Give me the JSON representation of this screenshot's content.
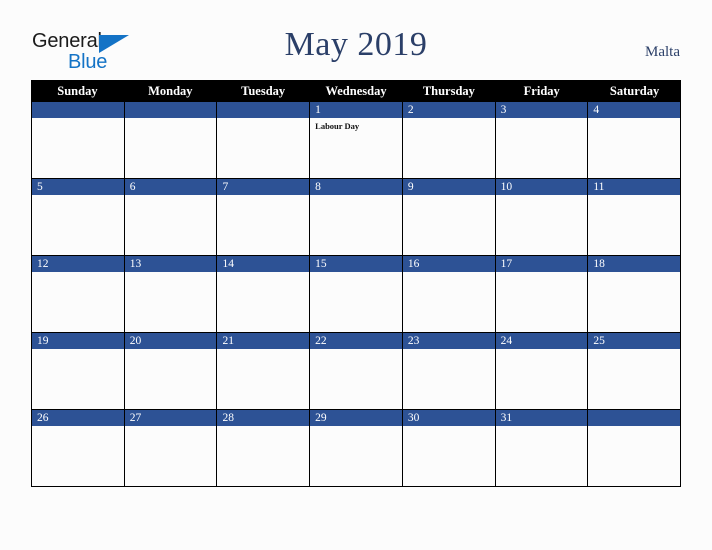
{
  "brand": {
    "logo_text_top": "General",
    "logo_text_bottom": "Blue",
    "logo_color_top": "#1b1b1b",
    "logo_color_bottom": "#1473c6",
    "triangle_color": "#1473c6"
  },
  "header": {
    "title": "May 2019",
    "country": "Malta",
    "title_color": "#2b3f68"
  },
  "theme": {
    "background": "#fcfcfc",
    "header_row_background": "#000000",
    "header_row_text": "#ffffff",
    "date_bar_background": "#2d5295",
    "date_bar_text": "#ffffff",
    "grid_line": "#000000"
  },
  "calendar": {
    "month": "May",
    "year": "2019",
    "day_headers": [
      "Sunday",
      "Monday",
      "Tuesday",
      "Wednesday",
      "Thursday",
      "Friday",
      "Saturday"
    ],
    "weeks": [
      [
        {
          "date": "",
          "event": ""
        },
        {
          "date": "",
          "event": ""
        },
        {
          "date": "",
          "event": ""
        },
        {
          "date": "1",
          "event": "Labour Day"
        },
        {
          "date": "2",
          "event": ""
        },
        {
          "date": "3",
          "event": ""
        },
        {
          "date": "4",
          "event": ""
        }
      ],
      [
        {
          "date": "5",
          "event": ""
        },
        {
          "date": "6",
          "event": ""
        },
        {
          "date": "7",
          "event": ""
        },
        {
          "date": "8",
          "event": ""
        },
        {
          "date": "9",
          "event": ""
        },
        {
          "date": "10",
          "event": ""
        },
        {
          "date": "11",
          "event": ""
        }
      ],
      [
        {
          "date": "12",
          "event": ""
        },
        {
          "date": "13",
          "event": ""
        },
        {
          "date": "14",
          "event": ""
        },
        {
          "date": "15",
          "event": ""
        },
        {
          "date": "16",
          "event": ""
        },
        {
          "date": "17",
          "event": ""
        },
        {
          "date": "18",
          "event": ""
        }
      ],
      [
        {
          "date": "19",
          "event": ""
        },
        {
          "date": "20",
          "event": ""
        },
        {
          "date": "21",
          "event": ""
        },
        {
          "date": "22",
          "event": ""
        },
        {
          "date": "23",
          "event": ""
        },
        {
          "date": "24",
          "event": ""
        },
        {
          "date": "25",
          "event": ""
        }
      ],
      [
        {
          "date": "26",
          "event": ""
        },
        {
          "date": "27",
          "event": ""
        },
        {
          "date": "28",
          "event": ""
        },
        {
          "date": "29",
          "event": ""
        },
        {
          "date": "30",
          "event": ""
        },
        {
          "date": "31",
          "event": ""
        },
        {
          "date": "",
          "event": ""
        }
      ]
    ]
  }
}
